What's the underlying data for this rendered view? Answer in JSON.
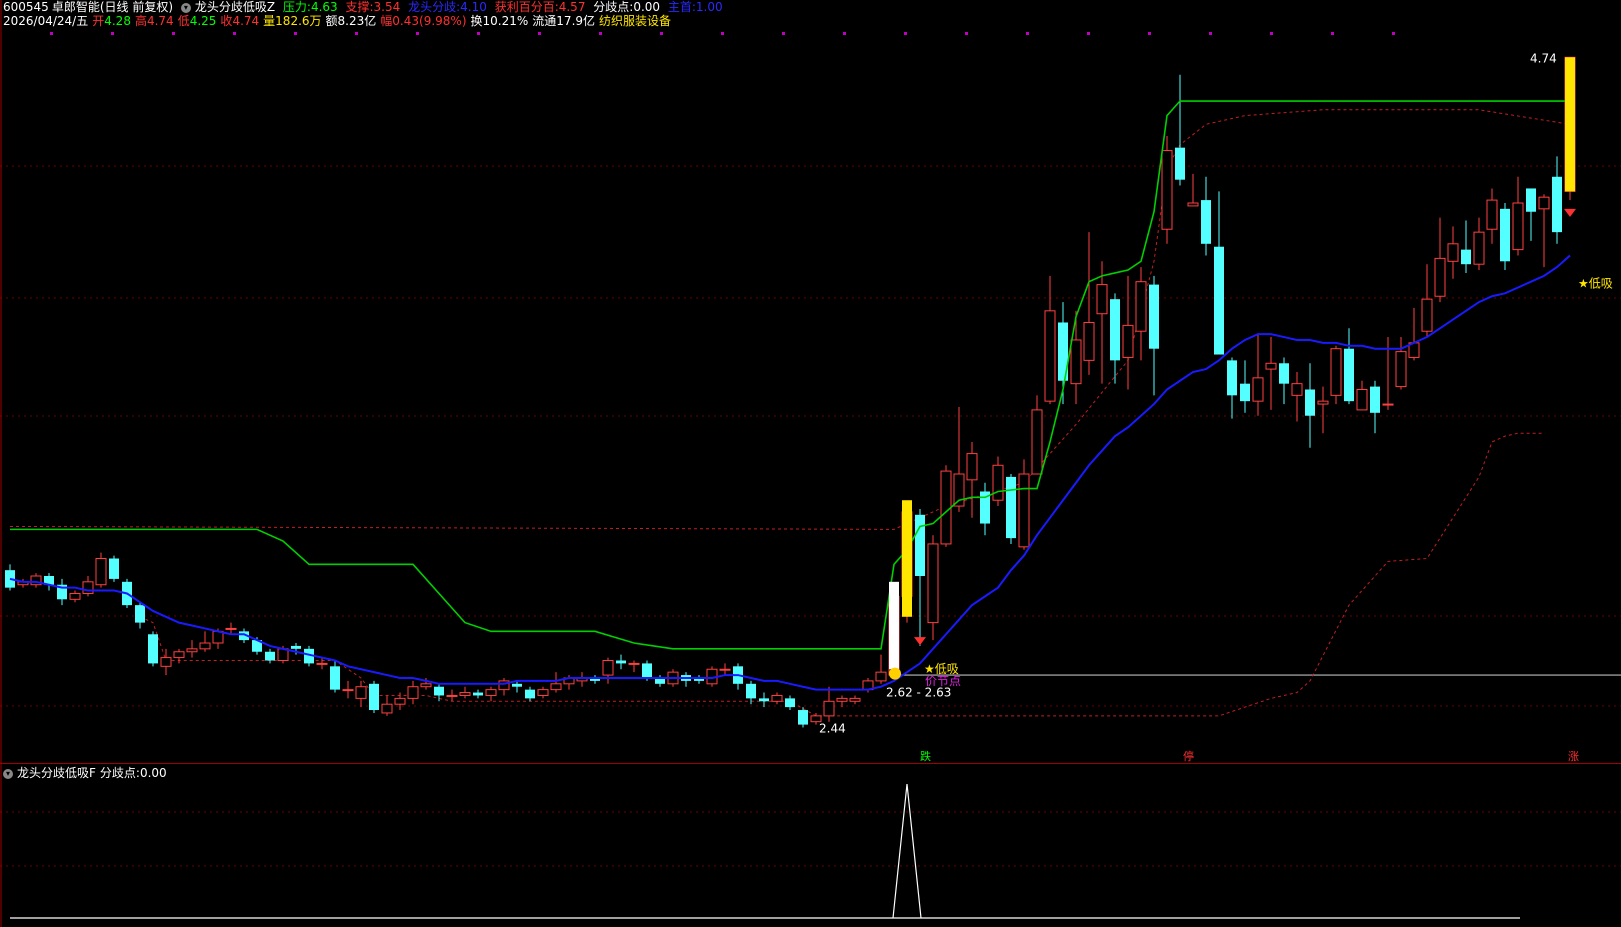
{
  "header": {
    "code": "600545",
    "name": "卓郎智能",
    "period": "(日线 前复权)",
    "indicator_name": "龙头分歧低吸Z",
    "pressure_label": "压力:",
    "pressure_value": "4.63",
    "support_label": "支撑:",
    "support_value": "3.54",
    "divergence_label": "龙头分歧:",
    "divergence_value": "4.10",
    "profit_label": "获利百分百:",
    "profit_value": "4.57",
    "fork_label": "分歧点:",
    "fork_value": "0.00",
    "main_label": "主首:",
    "main_value": "1.00",
    "date": "2026/04/24/五",
    "open_label": "开",
    "open_value": "4.28",
    "high_label": "高",
    "high_value": "4.74",
    "low_label": "低",
    "low_value": "4.25",
    "close_label": "收",
    "close_value": "4.74",
    "vol_label": "量",
    "vol_value": "182.6万",
    "amount_label": "额",
    "amount_value": "8.23亿",
    "change_label": "幅",
    "change_value": "0.43(9.98%)",
    "turnover_label": "换",
    "turnover_value": "10.21%",
    "float_label": "流通",
    "float_value": "17.9亿",
    "industry": "纺织服装设备"
  },
  "sub_header": {
    "indicator_name": "龙头分歧低吸F",
    "fork_label": "分歧点:",
    "fork_value": "0.00"
  },
  "annotations": {
    "max_price": "4.74",
    "min_price": "2.44",
    "range_label": "2.62 - 2.63",
    "low_buy_1": "★低吸",
    "low_buy_2": "★低吸",
    "price_node": "价节点",
    "fall_mark": "跌",
    "stop_mark": "停",
    "rise_mark": "涨"
  },
  "colors": {
    "up": "#ff4040",
    "down": "#54ffff",
    "ma": "#1a1aff",
    "resistance": "#00d000",
    "dashed": "#c02020",
    "signal": "#ffe600",
    "grid": "#6a0000"
  },
  "chart_data": {
    "type": "candlestick",
    "y_range": [
      2.38,
      4.82
    ],
    "candles": [
      [
        2.98,
        2.92,
        3.0,
        2.91
      ],
      [
        2.93,
        2.94,
        2.95,
        2.92
      ],
      [
        2.93,
        2.96,
        2.97,
        2.92
      ],
      [
        2.96,
        2.93,
        2.97,
        2.91
      ],
      [
        2.93,
        2.88,
        2.95,
        2.86
      ],
      [
        2.88,
        2.9,
        2.91,
        2.87
      ],
      [
        2.9,
        2.94,
        2.96,
        2.89
      ],
      [
        2.93,
        3.02,
        3.04,
        2.92
      ],
      [
        3.02,
        2.95,
        3.03,
        2.94
      ],
      [
        2.94,
        2.86,
        2.95,
        2.85
      ],
      [
        2.86,
        2.8,
        2.87,
        2.78
      ],
      [
        2.76,
        2.66,
        2.77,
        2.65
      ],
      [
        2.65,
        2.68,
        2.71,
        2.62
      ],
      [
        2.68,
        2.7,
        2.71,
        2.66
      ],
      [
        2.7,
        2.71,
        2.74,
        2.68
      ],
      [
        2.71,
        2.73,
        2.77,
        2.7
      ],
      [
        2.73,
        2.77,
        2.78,
        2.71
      ],
      [
        2.78,
        2.78,
        2.8,
        2.76
      ],
      [
        2.77,
        2.74,
        2.78,
        2.73
      ],
      [
        2.74,
        2.7,
        2.75,
        2.69
      ],
      [
        2.7,
        2.67,
        2.71,
        2.66
      ],
      [
        2.67,
        2.71,
        2.72,
        2.66
      ],
      [
        2.72,
        2.71,
        2.73,
        2.69
      ],
      [
        2.71,
        2.66,
        2.72,
        2.65
      ],
      [
        2.66,
        2.66,
        2.68,
        2.64
      ],
      [
        2.65,
        2.57,
        2.67,
        2.56
      ],
      [
        2.57,
        2.57,
        2.6,
        2.54
      ],
      [
        2.54,
        2.58,
        2.6,
        2.51
      ],
      [
        2.59,
        2.5,
        2.6,
        2.49
      ],
      [
        2.49,
        2.52,
        2.55,
        2.48
      ],
      [
        2.52,
        2.54,
        2.56,
        2.5
      ],
      [
        2.54,
        2.58,
        2.6,
        2.52
      ],
      [
        2.58,
        2.59,
        2.61,
        2.57
      ],
      [
        2.58,
        2.55,
        2.59,
        2.53
      ],
      [
        2.55,
        2.55,
        2.57,
        2.53
      ],
      [
        2.55,
        2.56,
        2.58,
        2.54
      ],
      [
        2.56,
        2.55,
        2.57,
        2.54
      ],
      [
        2.55,
        2.57,
        2.58,
        2.53
      ],
      [
        2.57,
        2.6,
        2.61,
        2.55
      ],
      [
        2.59,
        2.58,
        2.6,
        2.56
      ],
      [
        2.57,
        2.54,
        2.58,
        2.53
      ],
      [
        2.55,
        2.57,
        2.58,
        2.54
      ],
      [
        2.57,
        2.59,
        2.63,
        2.56
      ],
      [
        2.59,
        2.61,
        2.62,
        2.57
      ],
      [
        2.6,
        2.61,
        2.63,
        2.58
      ],
      [
        2.61,
        2.6,
        2.62,
        2.59
      ],
      [
        2.62,
        2.67,
        2.68,
        2.59
      ],
      [
        2.67,
        2.66,
        2.69,
        2.64
      ],
      [
        2.66,
        2.66,
        2.67,
        2.63
      ],
      [
        2.66,
        2.61,
        2.67,
        2.6
      ],
      [
        2.61,
        2.59,
        2.62,
        2.58
      ],
      [
        2.59,
        2.63,
        2.64,
        2.58
      ],
      [
        2.62,
        2.6,
        2.63,
        2.58
      ],
      [
        2.61,
        2.6,
        2.62,
        2.59
      ],
      [
        2.59,
        2.64,
        2.65,
        2.58
      ],
      [
        2.64,
        2.64,
        2.66,
        2.62
      ],
      [
        2.65,
        2.59,
        2.66,
        2.57
      ],
      [
        2.59,
        2.54,
        2.6,
        2.52
      ],
      [
        2.54,
        2.53,
        2.56,
        2.51
      ],
      [
        2.53,
        2.55,
        2.56,
        2.52
      ],
      [
        2.54,
        2.51,
        2.55,
        2.5
      ],
      [
        2.5,
        2.45,
        2.51,
        2.44
      ],
      [
        2.46,
        2.48,
        2.49,
        2.45
      ],
      [
        2.48,
        2.53,
        2.58,
        2.46
      ],
      [
        2.53,
        2.54,
        2.55,
        2.51
      ],
      [
        2.53,
        2.54,
        2.55,
        2.52
      ],
      [
        2.57,
        2.6,
        2.61,
        2.56
      ],
      [
        2.6,
        2.63,
        2.69,
        2.59
      ],
      [
        2.62,
        2.89,
        2.89,
        2.62
      ],
      [
        2.89,
        3.18,
        3.19,
        2.8
      ],
      [
        3.17,
        2.96,
        3.19,
        2.72
      ],
      [
        2.8,
        3.07,
        3.1,
        2.74
      ],
      [
        3.07,
        3.32,
        3.34,
        3.06
      ],
      [
        3.2,
        3.31,
        3.54,
        3.18
      ],
      [
        3.29,
        3.38,
        3.42,
        3.16
      ],
      [
        3.25,
        3.14,
        3.28,
        3.1
      ],
      [
        3.22,
        3.34,
        3.37,
        3.2
      ],
      [
        3.3,
        3.09,
        3.31,
        3.07
      ],
      [
        3.06,
        3.31,
        3.36,
        3.05
      ],
      [
        3.31,
        3.53,
        3.58,
        3.49
      ],
      [
        3.56,
        3.87,
        3.99,
        3.55
      ],
      [
        3.83,
        3.63,
        3.9,
        3.55
      ],
      [
        3.62,
        3.77,
        3.87,
        3.55
      ],
      [
        3.7,
        3.83,
        4.14,
        3.65
      ],
      [
        3.86,
        3.96,
        4.04,
        3.62
      ],
      [
        3.91,
        3.7,
        3.93,
        3.62
      ],
      [
        3.71,
        3.82,
        3.99,
        3.6
      ],
      [
        3.8,
        3.97,
        4.02,
        3.7
      ],
      [
        3.96,
        3.74,
        3.99,
        3.58
      ],
      [
        4.15,
        4.42,
        4.47,
        4.1
      ],
      [
        4.43,
        4.32,
        4.68,
        4.3
      ],
      [
        4.23,
        4.24,
        4.34,
        4.23
      ],
      [
        4.25,
        4.1,
        4.33,
        4.06
      ],
      [
        4.09,
        3.72,
        4.28,
        3.72
      ],
      [
        3.7,
        3.58,
        3.71,
        3.5
      ],
      [
        3.62,
        3.56,
        3.7,
        3.52
      ],
      [
        3.56,
        3.64,
        3.79,
        3.51
      ],
      [
        3.67,
        3.69,
        3.78,
        3.53
      ],
      [
        3.69,
        3.62,
        3.71,
        3.55
      ],
      [
        3.58,
        3.62,
        3.66,
        3.49
      ],
      [
        3.6,
        3.51,
        3.69,
        3.4
      ],
      [
        3.55,
        3.56,
        3.61,
        3.45
      ],
      [
        3.58,
        3.74,
        3.75,
        3.55
      ],
      [
        3.74,
        3.56,
        3.81,
        3.55
      ],
      [
        3.53,
        3.6,
        3.63,
        3.54
      ],
      [
        3.61,
        3.52,
        3.63,
        3.45
      ],
      [
        3.55,
        3.55,
        3.78,
        3.53
      ],
      [
        3.61,
        3.73,
        3.78,
        3.6
      ],
      [
        3.71,
        3.76,
        3.88,
        3.7
      ],
      [
        3.8,
        3.91,
        4.03,
        3.78
      ],
      [
        3.92,
        4.05,
        4.19,
        3.9
      ],
      [
        4.04,
        4.1,
        4.16,
        3.98
      ],
      [
        4.08,
        4.03,
        4.18,
        4.0
      ],
      [
        4.03,
        4.14,
        4.19,
        4.01
      ],
      [
        4.15,
        4.25,
        4.29,
        4.1
      ],
      [
        4.22,
        4.04,
        4.24,
        4.01
      ],
      [
        4.08,
        4.24,
        4.33,
        4.06
      ],
      [
        4.29,
        4.21,
        4.29,
        4.11
      ],
      [
        4.22,
        4.26,
        4.27,
        4.02
      ],
      [
        4.33,
        4.14,
        4.4,
        4.1
      ],
      [
        4.28,
        4.74,
        4.74,
        4.25
      ]
    ],
    "ma": [
      2.95,
      2.94,
      2.94,
      2.93,
      2.92,
      2.92,
      2.91,
      2.91,
      2.91,
      2.9,
      2.87,
      2.84,
      2.82,
      2.8,
      2.79,
      2.78,
      2.77,
      2.76,
      2.76,
      2.74,
      2.72,
      2.71,
      2.7,
      2.69,
      2.68,
      2.67,
      2.65,
      2.64,
      2.63,
      2.62,
      2.61,
      2.61,
      2.6,
      2.59,
      2.59,
      2.59,
      2.59,
      2.59,
      2.59,
      2.6,
      2.6,
      2.6,
      2.6,
      2.61,
      2.61,
      2.61,
      2.61,
      2.61,
      2.61,
      2.61,
      2.61,
      2.61,
      2.61,
      2.61,
      2.61,
      2.62,
      2.62,
      2.61,
      2.6,
      2.6,
      2.59,
      2.58,
      2.57,
      2.57,
      2.57,
      2.57,
      2.57,
      2.58,
      2.6,
      2.63,
      2.66,
      2.71,
      2.76,
      2.81,
      2.86,
      2.89,
      2.92,
      2.98,
      3.03,
      3.1,
      3.16,
      3.22,
      3.28,
      3.34,
      3.39,
      3.44,
      3.47,
      3.51,
      3.55,
      3.6,
      3.63,
      3.66,
      3.67,
      3.7,
      3.74,
      3.77,
      3.79,
      3.79,
      3.78,
      3.77,
      3.77,
      3.76,
      3.76,
      3.75,
      3.75,
      3.74,
      3.74,
      3.74,
      3.76,
      3.78,
      3.81,
      3.84,
      3.87,
      3.9,
      3.92,
      3.93,
      3.95,
      3.97,
      3.99,
      4.02,
      4.06
    ],
    "resistance": [
      [
        0,
        3.12
      ],
      [
        19,
        3.12
      ],
      [
        21,
        3.08
      ],
      [
        23,
        3.0
      ],
      [
        31,
        3.0
      ],
      [
        33,
        2.9
      ],
      [
        35,
        2.8
      ],
      [
        37,
        2.77
      ],
      [
        45,
        2.77
      ],
      [
        48,
        2.73
      ],
      [
        51,
        2.71
      ],
      [
        67,
        2.71
      ],
      [
        68,
        3.0
      ],
      [
        69,
        3.05
      ],
      [
        70,
        3.13
      ],
      [
        71,
        3.14
      ],
      [
        72,
        3.18
      ],
      [
        73,
        3.22
      ],
      [
        74,
        3.23
      ],
      [
        75,
        3.23
      ],
      [
        76,
        3.25
      ],
      [
        78,
        3.26
      ],
      [
        79,
        3.26
      ],
      [
        80,
        3.42
      ],
      [
        81,
        3.6
      ],
      [
        82,
        3.85
      ],
      [
        83,
        3.97
      ],
      [
        84,
        3.99
      ],
      [
        85,
        4.0
      ],
      [
        86,
        4.01
      ],
      [
        87,
        4.04
      ],
      [
        88,
        4.21
      ],
      [
        89,
        4.54
      ],
      [
        90,
        4.59
      ],
      [
        107,
        4.59
      ],
      [
        120,
        4.59
      ]
    ],
    "dashed_top": [
      [
        0,
        3.13
      ],
      [
        68,
        3.12
      ],
      [
        72,
        3.2
      ],
      [
        78,
        3.28
      ],
      [
        82,
        3.48
      ],
      [
        86,
        3.7
      ],
      [
        88,
        4.04
      ],
      [
        89,
        4.36
      ],
      [
        90,
        4.44
      ],
      [
        92,
        4.51
      ],
      [
        95,
        4.54
      ],
      [
        101,
        4.56
      ],
      [
        107,
        4.56
      ],
      [
        113,
        4.56
      ],
      [
        120,
        4.51
      ]
    ],
    "dashed_bottom": [
      [
        10,
        2.82
      ],
      [
        11,
        2.8
      ],
      [
        12,
        2.67
      ],
      [
        25,
        2.67
      ],
      [
        27,
        2.61
      ],
      [
        28,
        2.55
      ],
      [
        32,
        2.55
      ],
      [
        34,
        2.53
      ],
      [
        60,
        2.53
      ],
      [
        62,
        2.48
      ],
      [
        63,
        2.48
      ],
      [
        93,
        2.48
      ],
      [
        97,
        2.54
      ],
      [
        99,
        2.56
      ],
      [
        100,
        2.6
      ],
      [
        103,
        2.86
      ],
      [
        105,
        2.96
      ],
      [
        106,
        3.01
      ],
      [
        109,
        3.02
      ],
      [
        113,
        3.3
      ],
      [
        114,
        3.42
      ],
      [
        115,
        3.44
      ],
      [
        116,
        3.45
      ],
      [
        118,
        3.45
      ]
    ],
    "sub_pulse_index": 69
  }
}
